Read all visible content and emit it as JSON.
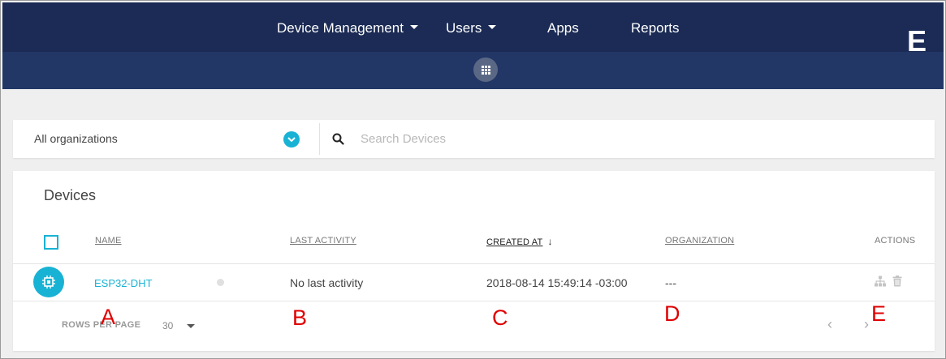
{
  "nav": {
    "items": [
      {
        "label": "Device Management",
        "caret": true
      },
      {
        "label": "Users",
        "caret": true
      },
      {
        "label": "Apps",
        "caret": false
      },
      {
        "label": "Reports",
        "caret": false
      }
    ],
    "apps_icon": "grid-icon"
  },
  "corner_letter": "E",
  "filter": {
    "organization": "All organizations",
    "search_placeholder": "Search Devices"
  },
  "devices": {
    "title": "Devices",
    "columns": {
      "name": "NAME",
      "last_activity": "LAST ACTIVITY",
      "created_at": "CREATED AT",
      "created_sort": "↓",
      "organization": "ORGANIZATION",
      "actions": "ACTIONS"
    },
    "rows": [
      {
        "name": "ESP32-DHT",
        "last_activity": "No last activity",
        "created_at": "2018-08-14 15:49:14 -03:00",
        "organization": "---"
      }
    ],
    "footer": {
      "rows_per_page_label": "ROWS PER PAGE",
      "rows_per_page": "30",
      "prev": "‹",
      "next": "›"
    }
  },
  "annotations": [
    "A",
    "B",
    "C",
    "D",
    "E"
  ],
  "colors": {
    "navbar": "#1b2b55",
    "navbar_lower": "#223766",
    "accent": "#18b3d4",
    "annotation": "#e00000"
  }
}
